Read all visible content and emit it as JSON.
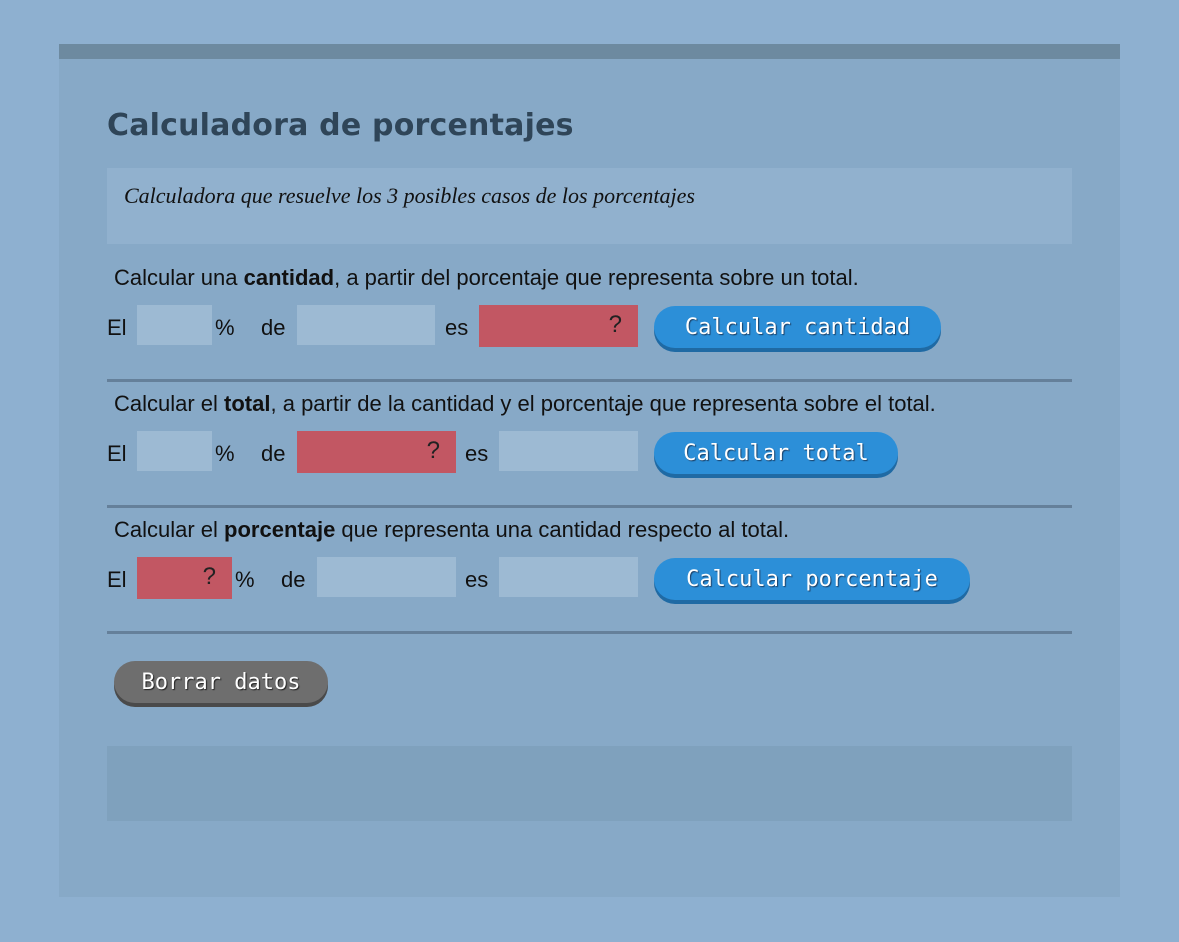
{
  "title": "Calculadora de porcentajes",
  "description": "Calculadora que resuelve los 3 posibles casos de los porcentajes",
  "sections": [
    {
      "title_pre": "Calcular una ",
      "title_bold": "cantidad",
      "title_post": ", a partir del porcentaje que representa sobre un total.",
      "label_el": "El",
      "label_pct": "%",
      "label_de": "de",
      "label_es": "es",
      "unknown": "?",
      "button": "Calcular cantidad"
    },
    {
      "title_pre": "Calcular el ",
      "title_bold": "total",
      "title_post": ", a partir de la cantidad y el porcentaje que representa sobre el total.",
      "label_el": "El",
      "label_pct": "%",
      "label_de": "de",
      "label_es": "es",
      "unknown": "?",
      "button": "Calcular total"
    },
    {
      "title_pre": "Calcular el ",
      "title_bold": "porcentaje",
      "title_post": " que representa una cantidad respecto al total.",
      "label_el": "El",
      "label_pct": "%",
      "label_de": "de",
      "label_es": "es",
      "unknown": "?",
      "button": "Calcular porcentaje"
    }
  ],
  "clear_button": "Borrar datos",
  "colors": {
    "background": "#8eb0d0",
    "panel": "#87a9c7",
    "unknown_field": "#c25763",
    "input_field": "#9dbad3",
    "primary_button": "#2c8fd8",
    "clear_button": "#6e6e6e"
  }
}
